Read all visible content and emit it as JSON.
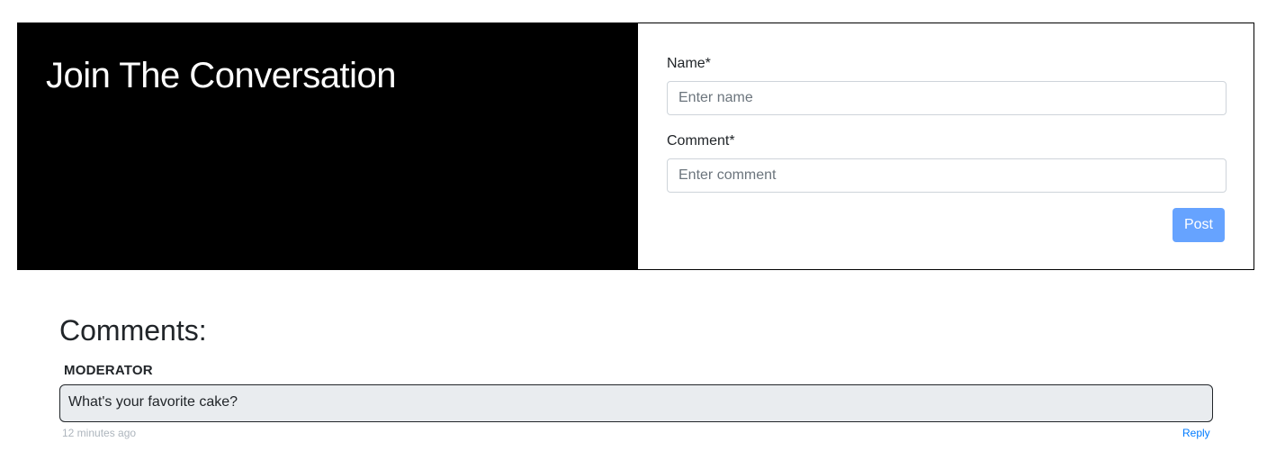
{
  "join": {
    "title": "Join The Conversation",
    "name_label": "Name*",
    "name_placeholder": "Enter name",
    "name_value": "",
    "comment_label": "Comment*",
    "comment_placeholder": "Enter comment",
    "comment_value": "",
    "post_label": "Post"
  },
  "comments": {
    "heading": "Comments:",
    "items": [
      {
        "author": "MODERATOR",
        "text": "What's your favorite cake?",
        "time": "12 minutes ago",
        "reply_label": "Reply"
      }
    ]
  },
  "colors": {
    "panel_left_bg": "#000000",
    "post_button_bg": "#66a3ff",
    "comment_bubble_bg": "#e9ecef",
    "reply_link": "#007bff",
    "timestamp": "#adb5bd"
  }
}
